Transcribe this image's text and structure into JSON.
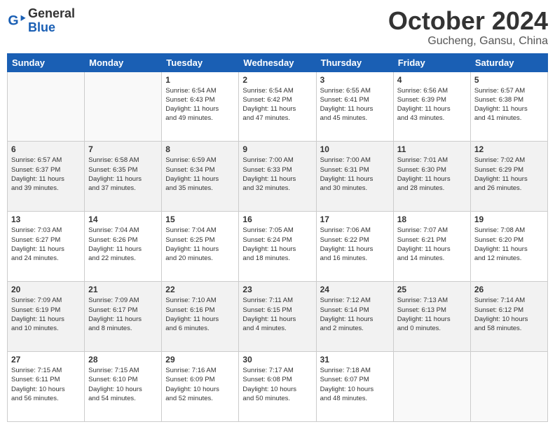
{
  "header": {
    "logo_line1": "General",
    "logo_line2": "Blue",
    "month": "October 2024",
    "location": "Gucheng, Gansu, China"
  },
  "weekdays": [
    "Sunday",
    "Monday",
    "Tuesday",
    "Wednesday",
    "Thursday",
    "Friday",
    "Saturday"
  ],
  "weeks": [
    [
      {
        "day": "",
        "info": ""
      },
      {
        "day": "",
        "info": ""
      },
      {
        "day": "1",
        "info": "Sunrise: 6:54 AM\nSunset: 6:43 PM\nDaylight: 11 hours\nand 49 minutes."
      },
      {
        "day": "2",
        "info": "Sunrise: 6:54 AM\nSunset: 6:42 PM\nDaylight: 11 hours\nand 47 minutes."
      },
      {
        "day": "3",
        "info": "Sunrise: 6:55 AM\nSunset: 6:41 PM\nDaylight: 11 hours\nand 45 minutes."
      },
      {
        "day": "4",
        "info": "Sunrise: 6:56 AM\nSunset: 6:39 PM\nDaylight: 11 hours\nand 43 minutes."
      },
      {
        "day": "5",
        "info": "Sunrise: 6:57 AM\nSunset: 6:38 PM\nDaylight: 11 hours\nand 41 minutes."
      }
    ],
    [
      {
        "day": "6",
        "info": "Sunrise: 6:57 AM\nSunset: 6:37 PM\nDaylight: 11 hours\nand 39 minutes."
      },
      {
        "day": "7",
        "info": "Sunrise: 6:58 AM\nSunset: 6:35 PM\nDaylight: 11 hours\nand 37 minutes."
      },
      {
        "day": "8",
        "info": "Sunrise: 6:59 AM\nSunset: 6:34 PM\nDaylight: 11 hours\nand 35 minutes."
      },
      {
        "day": "9",
        "info": "Sunrise: 7:00 AM\nSunset: 6:33 PM\nDaylight: 11 hours\nand 32 minutes."
      },
      {
        "day": "10",
        "info": "Sunrise: 7:00 AM\nSunset: 6:31 PM\nDaylight: 11 hours\nand 30 minutes."
      },
      {
        "day": "11",
        "info": "Sunrise: 7:01 AM\nSunset: 6:30 PM\nDaylight: 11 hours\nand 28 minutes."
      },
      {
        "day": "12",
        "info": "Sunrise: 7:02 AM\nSunset: 6:29 PM\nDaylight: 11 hours\nand 26 minutes."
      }
    ],
    [
      {
        "day": "13",
        "info": "Sunrise: 7:03 AM\nSunset: 6:27 PM\nDaylight: 11 hours\nand 24 minutes."
      },
      {
        "day": "14",
        "info": "Sunrise: 7:04 AM\nSunset: 6:26 PM\nDaylight: 11 hours\nand 22 minutes."
      },
      {
        "day": "15",
        "info": "Sunrise: 7:04 AM\nSunset: 6:25 PM\nDaylight: 11 hours\nand 20 minutes."
      },
      {
        "day": "16",
        "info": "Sunrise: 7:05 AM\nSunset: 6:24 PM\nDaylight: 11 hours\nand 18 minutes."
      },
      {
        "day": "17",
        "info": "Sunrise: 7:06 AM\nSunset: 6:22 PM\nDaylight: 11 hours\nand 16 minutes."
      },
      {
        "day": "18",
        "info": "Sunrise: 7:07 AM\nSunset: 6:21 PM\nDaylight: 11 hours\nand 14 minutes."
      },
      {
        "day": "19",
        "info": "Sunrise: 7:08 AM\nSunset: 6:20 PM\nDaylight: 11 hours\nand 12 minutes."
      }
    ],
    [
      {
        "day": "20",
        "info": "Sunrise: 7:09 AM\nSunset: 6:19 PM\nDaylight: 11 hours\nand 10 minutes."
      },
      {
        "day": "21",
        "info": "Sunrise: 7:09 AM\nSunset: 6:17 PM\nDaylight: 11 hours\nand 8 minutes."
      },
      {
        "day": "22",
        "info": "Sunrise: 7:10 AM\nSunset: 6:16 PM\nDaylight: 11 hours\nand 6 minutes."
      },
      {
        "day": "23",
        "info": "Sunrise: 7:11 AM\nSunset: 6:15 PM\nDaylight: 11 hours\nand 4 minutes."
      },
      {
        "day": "24",
        "info": "Sunrise: 7:12 AM\nSunset: 6:14 PM\nDaylight: 11 hours\nand 2 minutes."
      },
      {
        "day": "25",
        "info": "Sunrise: 7:13 AM\nSunset: 6:13 PM\nDaylight: 11 hours\nand 0 minutes."
      },
      {
        "day": "26",
        "info": "Sunrise: 7:14 AM\nSunset: 6:12 PM\nDaylight: 10 hours\nand 58 minutes."
      }
    ],
    [
      {
        "day": "27",
        "info": "Sunrise: 7:15 AM\nSunset: 6:11 PM\nDaylight: 10 hours\nand 56 minutes."
      },
      {
        "day": "28",
        "info": "Sunrise: 7:15 AM\nSunset: 6:10 PM\nDaylight: 10 hours\nand 54 minutes."
      },
      {
        "day": "29",
        "info": "Sunrise: 7:16 AM\nSunset: 6:09 PM\nDaylight: 10 hours\nand 52 minutes."
      },
      {
        "day": "30",
        "info": "Sunrise: 7:17 AM\nSunset: 6:08 PM\nDaylight: 10 hours\nand 50 minutes."
      },
      {
        "day": "31",
        "info": "Sunrise: 7:18 AM\nSunset: 6:07 PM\nDaylight: 10 hours\nand 48 minutes."
      },
      {
        "day": "",
        "info": ""
      },
      {
        "day": "",
        "info": ""
      }
    ]
  ]
}
